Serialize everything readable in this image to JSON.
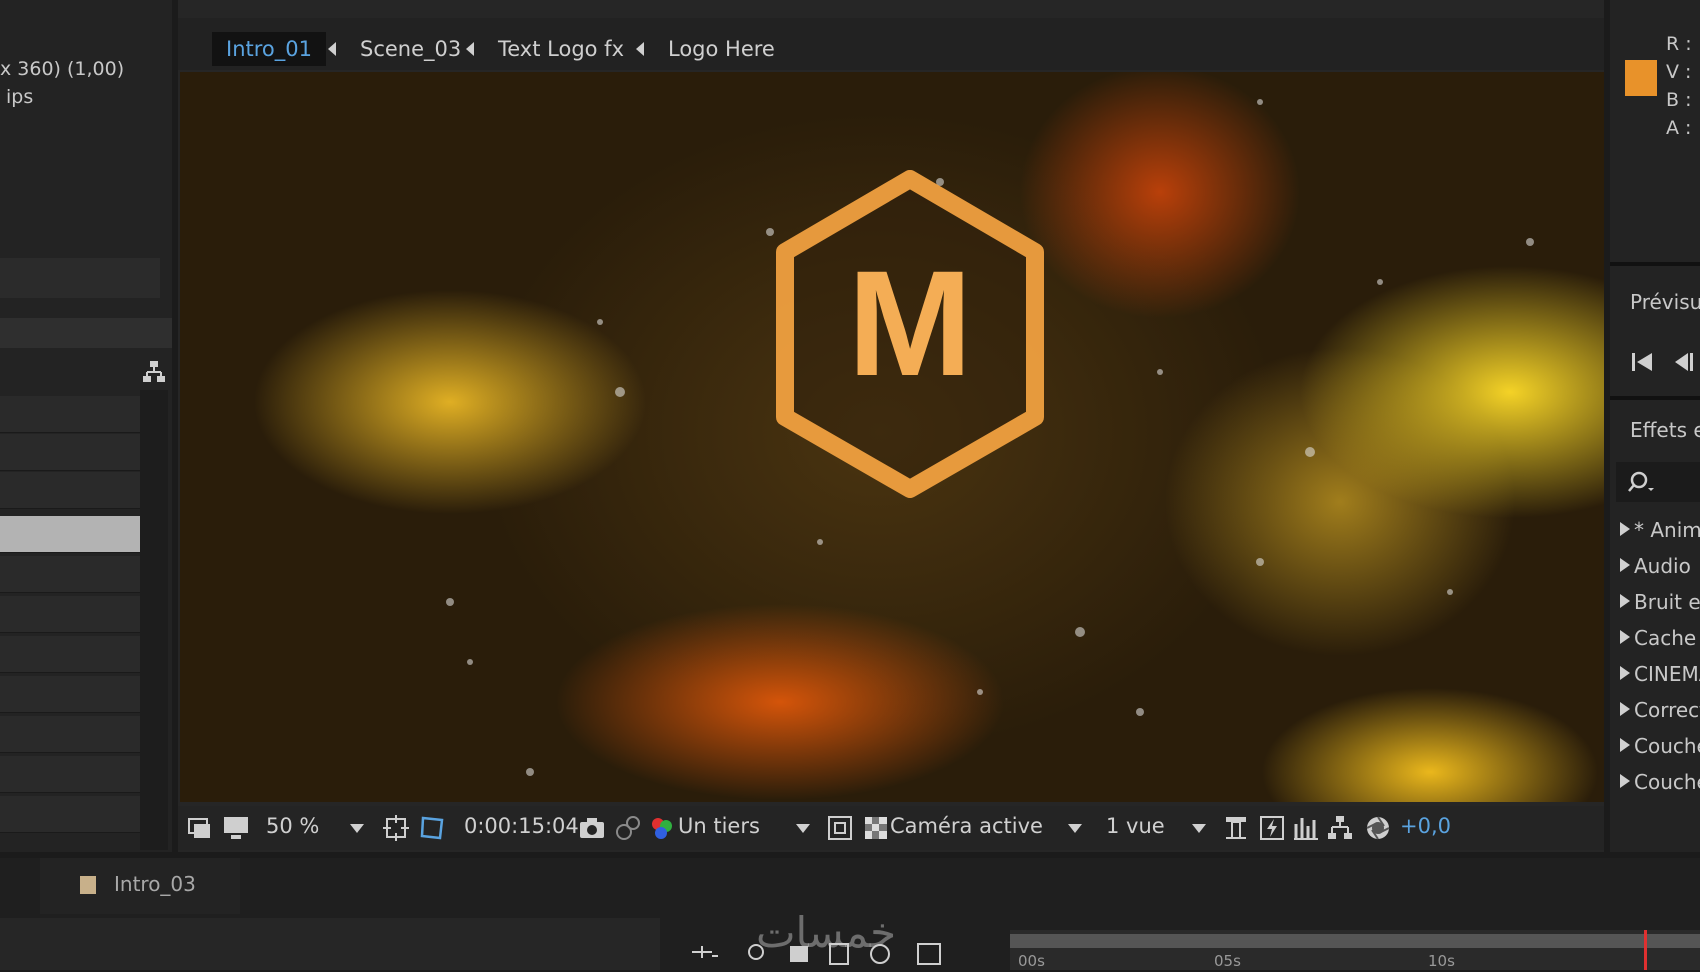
{
  "left_panel": {
    "info_line_1": "x 360) (1,00)",
    "info_line_2": "ips"
  },
  "viewer": {
    "breadcrumbs": [
      "Intro_01",
      "Scene_03",
      "Text Logo fx",
      "Logo Here"
    ],
    "logo_letter": "M",
    "toolbar": {
      "zoom": "50 %",
      "timecode": "0:00:15:04",
      "resolution": "Un tiers",
      "camera": "Caméra active",
      "views": "1 vue",
      "exposure": "+0,0"
    }
  },
  "right_panel": {
    "info_labels": [
      "R :",
      "V :",
      "B :",
      "A :"
    ],
    "color_swatch": "#e8922a",
    "preview_title": "Prévisua",
    "effects_title": "Effets e",
    "effects_items": [
      "* Anima",
      "Audio",
      "Bruit et",
      "Cache",
      "CINEMA",
      "Correct",
      "Couche",
      "Couche"
    ]
  },
  "timeline": {
    "comp_tab": "Intro_03",
    "ruler_labels": [
      "00s",
      "05s",
      "10s"
    ]
  },
  "watermark": "خمسات",
  "colors": {
    "accent_blue": "#5aa3e0",
    "logo_orange": "#f0a040"
  }
}
